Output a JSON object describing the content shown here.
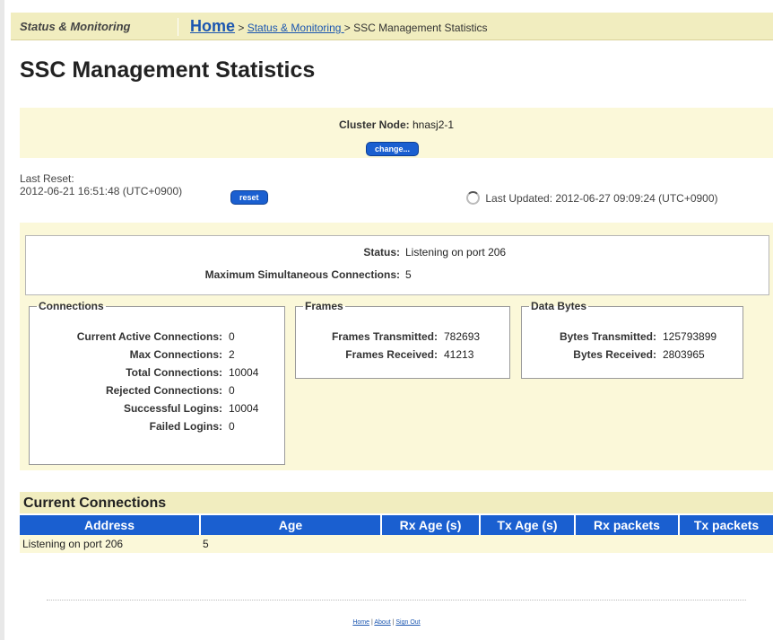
{
  "header": {
    "section": "Status & Monitoring",
    "breadcrumb": {
      "home": "Home",
      "sep1": " > ",
      "parent": "Status & Monitoring ",
      "sep2": " > ",
      "current": "SSC Management Statistics"
    }
  },
  "page_title": "SSC Management Statistics",
  "node": {
    "label": "Cluster Node:",
    "value": "hnasj2-1",
    "change_button": "change..."
  },
  "reset": {
    "label": "Last Reset:",
    "value": "2012-06-21 16:51:48 (UTC+0900)",
    "button": "reset"
  },
  "updated": {
    "label": "Last Updated:",
    "value": "2012-06-27 09:09:24 (UTC+0900)"
  },
  "status": {
    "status_label": "Status:",
    "status_value": "Listening on port 206",
    "max_label": "Maximum Simultaneous Connections:",
    "max_value": "5"
  },
  "connections": {
    "legend": "Connections",
    "rows": [
      {
        "label": "Current Active Connections:",
        "value": "0"
      },
      {
        "label": "Max Connections:",
        "value": "2"
      },
      {
        "label": "Total Connections:",
        "value": "10004"
      },
      {
        "label": "Rejected Connections:",
        "value": "0"
      },
      {
        "label": "Successful Logins:",
        "value": "10004"
      },
      {
        "label": "Failed Logins:",
        "value": "0"
      }
    ]
  },
  "frames": {
    "legend": "Frames",
    "rows": [
      {
        "label": "Frames Transmitted:",
        "value": "782693"
      },
      {
        "label": "Frames Received:",
        "value": "41213"
      }
    ]
  },
  "data_bytes": {
    "legend": "Data Bytes",
    "rows": [
      {
        "label": "Bytes Transmitted:",
        "value": "125793899"
      },
      {
        "label": "Bytes Received:",
        "value": "2803965"
      }
    ]
  },
  "current_connections": {
    "title": "Current Connections",
    "columns": [
      "Address",
      "Age",
      "Rx Age (s)",
      "Tx Age (s)",
      "Rx packets",
      "Tx packets"
    ],
    "rows": [
      [
        "Listening on port 206",
        "5",
        "",
        "",
        "",
        ""
      ]
    ]
  },
  "footer": {
    "home": "Home",
    "sep": " | ",
    "about": "About",
    "signout": "Sign Out"
  },
  "colors": {
    "bar_background": "#f1edbf",
    "panel_background": "#fbf8d9",
    "accent_blue": "#1a5fd0",
    "link_blue": "#1b56b0"
  },
  "icons": {
    "updated": "refresh-spinner-icon"
  }
}
